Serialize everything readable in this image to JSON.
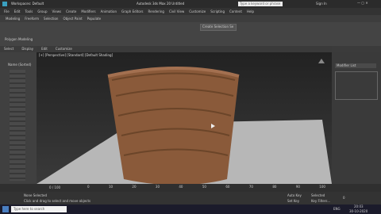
{
  "titlebar": {
    "workspace": "Workspaces: Default",
    "app_title": "Autodesk 3ds Max 20   Untitled",
    "search_placeholder": "Type a keyword or phrase",
    "user": "Sign In"
  },
  "menus": [
    "File",
    "Edit",
    "Tools",
    "Group",
    "Views",
    "Create",
    "Modifiers",
    "Animation",
    "Graph Editors",
    "Rendering",
    "Civil View",
    "Customize",
    "Scripting",
    "Content",
    "Help"
  ],
  "ribbon_tabs": [
    "Modeling",
    "Freeform",
    "Selection",
    "Object Paint",
    "Populate"
  ],
  "ribbon_label": "Polygon Modeling",
  "selection_set": "Create Selection Se",
  "scene_explorer": {
    "tabs": [
      "Select",
      "Display",
      "Edit",
      "Customize"
    ],
    "header": "Name (Sorted)"
  },
  "viewport_label": "[+] [Perspective] [Standard] [Default Shading]",
  "modifier_list": "Modifier List",
  "timeline": {
    "frame": "0 / 100",
    "ticks": [
      "0",
      "10",
      "20",
      "30",
      "40",
      "50",
      "60",
      "70",
      "80",
      "90",
      "100"
    ]
  },
  "status": {
    "selection": "None Selected",
    "prompt": "Click and drag to select and move objects",
    "autokey": "Auto Key",
    "set_key": "Set Key",
    "selected": "Selected",
    "key_filters": "Key Filters...",
    "frame": "0"
  },
  "taskbar": {
    "search": "Type here to search",
    "time": "20:03",
    "date": "30-10-2020",
    "lang": "ENG"
  },
  "colors": {
    "basket": "#8a5a3a",
    "accent": "#4a7fc1"
  }
}
